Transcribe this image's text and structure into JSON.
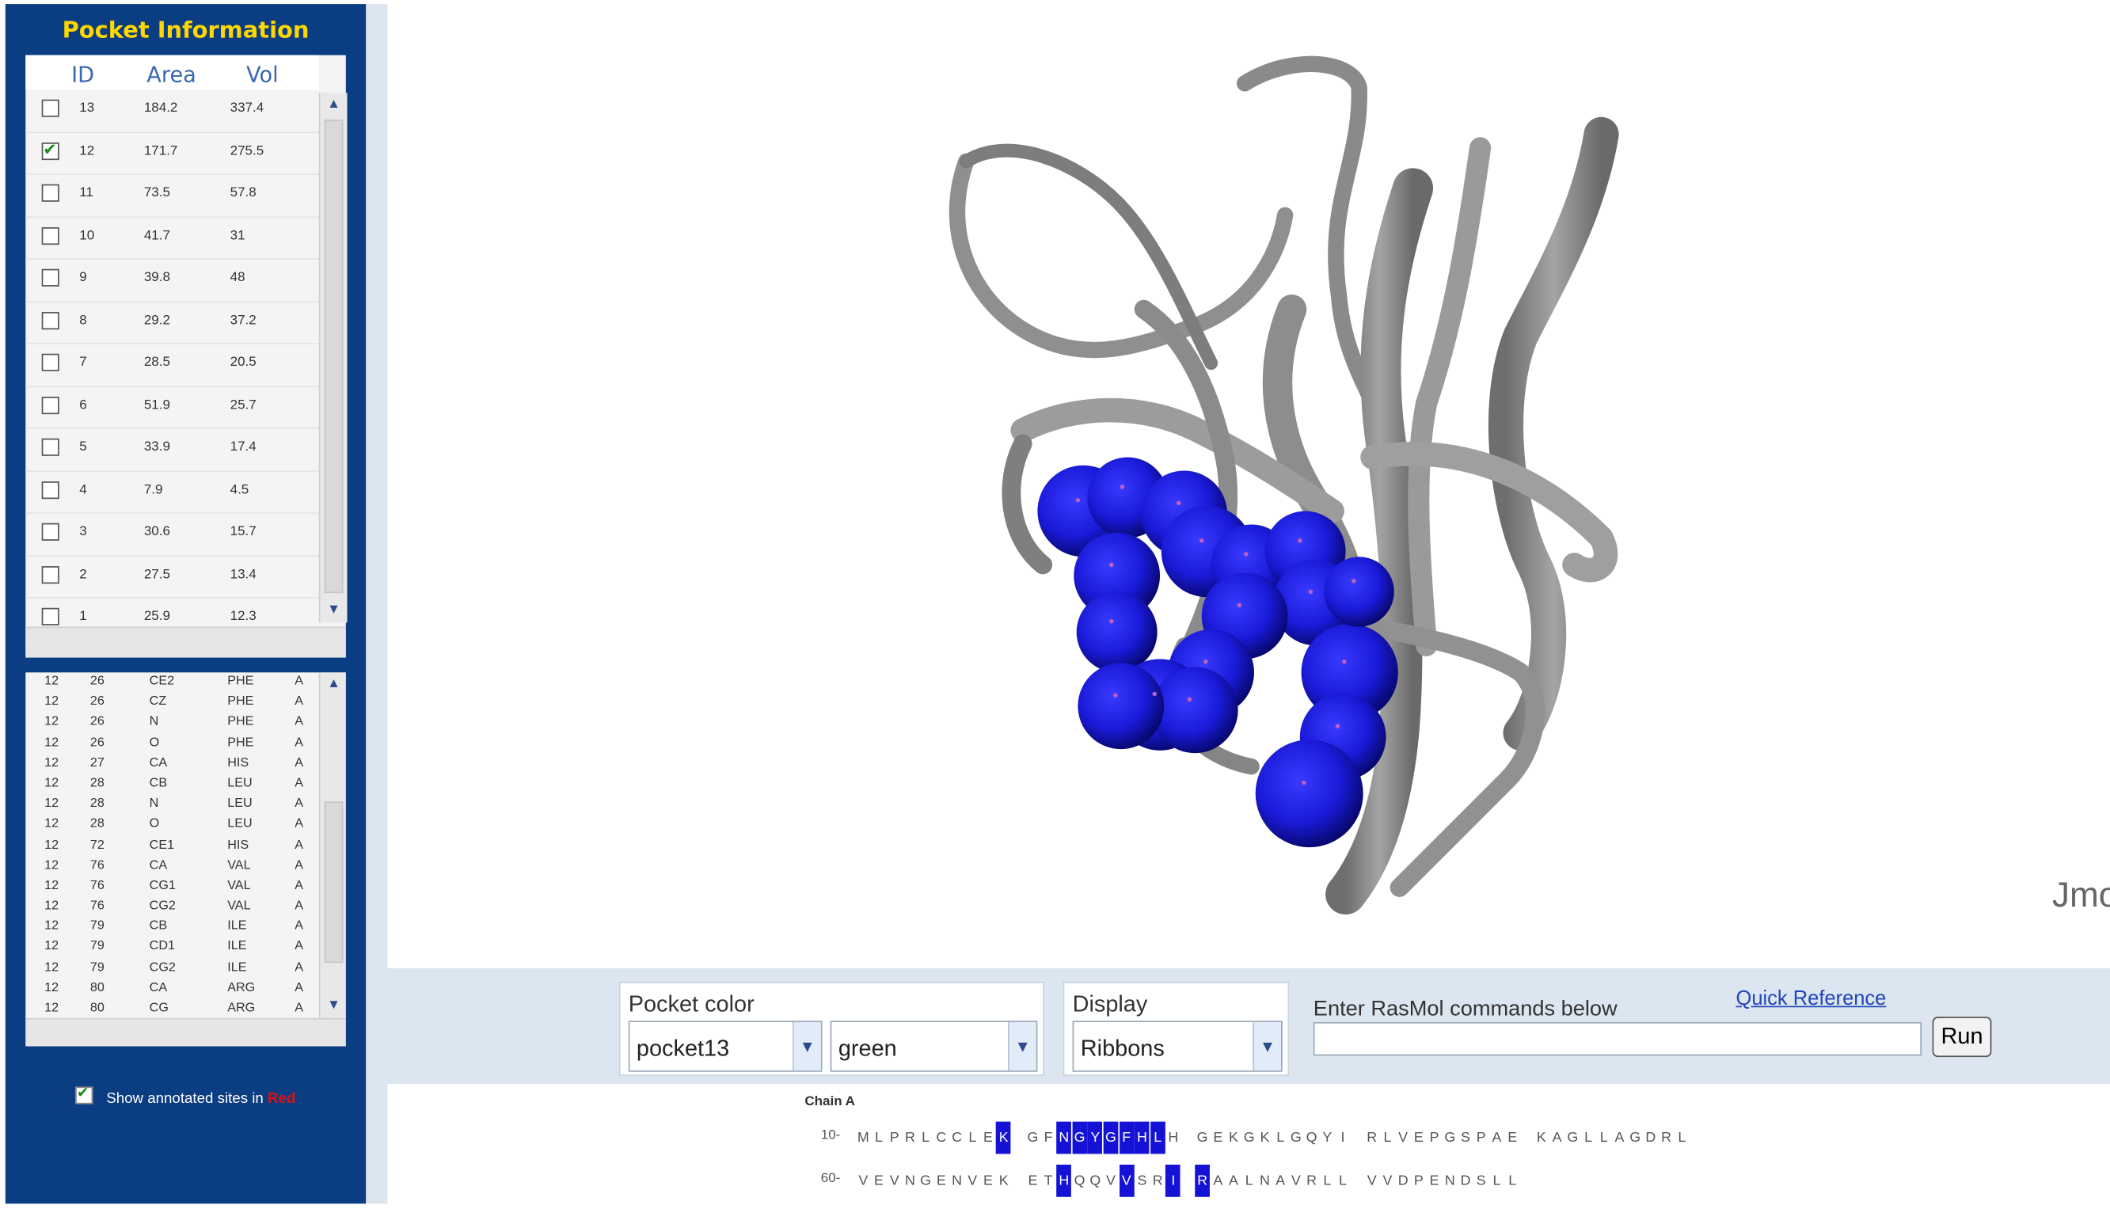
{
  "panel_title": "Pocket Information",
  "pocket_table": {
    "headers": {
      "id": "ID",
      "area": "Area",
      "vol": "Vol"
    },
    "rows": [
      {
        "id": "13",
        "area": "184.2",
        "vol": "337.4",
        "checked": false
      },
      {
        "id": "12",
        "area": "171.7",
        "vol": "275.5",
        "checked": true
      },
      {
        "id": "11",
        "area": "73.5",
        "vol": "57.8",
        "checked": false
      },
      {
        "id": "10",
        "area": "41.7",
        "vol": "31",
        "checked": false
      },
      {
        "id": "9",
        "area": "39.8",
        "vol": "48",
        "checked": false
      },
      {
        "id": "8",
        "area": "29.2",
        "vol": "37.2",
        "checked": false
      },
      {
        "id": "7",
        "area": "28.5",
        "vol": "20.5",
        "checked": false
      },
      {
        "id": "6",
        "area": "51.9",
        "vol": "25.7",
        "checked": false
      },
      {
        "id": "5",
        "area": "33.9",
        "vol": "17.4",
        "checked": false
      },
      {
        "id": "4",
        "area": "7.9",
        "vol": "4.5",
        "checked": false
      },
      {
        "id": "3",
        "area": "30.6",
        "vol": "15.7",
        "checked": false
      },
      {
        "id": "2",
        "area": "27.5",
        "vol": "13.4",
        "checked": false
      },
      {
        "id": "1",
        "area": "25.9",
        "vol": "12.3",
        "checked": false
      }
    ]
  },
  "atom_table": {
    "rows": [
      [
        "12",
        "26",
        "CE2",
        "PHE",
        "A"
      ],
      [
        "12",
        "26",
        "CZ",
        "PHE",
        "A"
      ],
      [
        "12",
        "26",
        "N",
        "PHE",
        "A"
      ],
      [
        "12",
        "26",
        "O",
        "PHE",
        "A"
      ],
      [
        "12",
        "27",
        "CA",
        "HIS",
        "A"
      ],
      [
        "12",
        "28",
        "CB",
        "LEU",
        "A"
      ],
      [
        "12",
        "28",
        "N",
        "LEU",
        "A"
      ],
      [
        "12",
        "28",
        "O",
        "LEU",
        "A"
      ],
      [
        "12",
        "72",
        "CE1",
        "HIS",
        "A"
      ],
      [
        "12",
        "76",
        "CA",
        "VAL",
        "A"
      ],
      [
        "12",
        "76",
        "CG1",
        "VAL",
        "A"
      ],
      [
        "12",
        "76",
        "CG2",
        "VAL",
        "A"
      ],
      [
        "12",
        "79",
        "CB",
        "ILE",
        "A"
      ],
      [
        "12",
        "79",
        "CD1",
        "ILE",
        "A"
      ],
      [
        "12",
        "79",
        "CG2",
        "ILE",
        "A"
      ],
      [
        "12",
        "80",
        "CA",
        "ARG",
        "A"
      ],
      [
        "12",
        "80",
        "CG",
        "ARG",
        "A"
      ]
    ]
  },
  "annotation": {
    "label": "Show annotated sites in",
    "color_word": "Red",
    "checked": true
  },
  "viewer": {
    "label": "Jmol"
  },
  "controls": {
    "pocket_color_label": "Pocket color",
    "pocket_select": "pocket13",
    "color_select": "green",
    "display_label": "Display",
    "display_select": "Ribbons",
    "rasmol_label": "Enter RasMol commands below",
    "quick_ref": "Quick Reference",
    "command_value": "",
    "run_label": "Run"
  },
  "sequence": {
    "chain_label": "Chain A",
    "lines": [
      {
        "num": "10-",
        "residues": "MLPRLCCLEKGFNGYGFHLHGEKGKLGQYIRLVEPGSPAEKAGLLAGDRL",
        "highlight": [
          9,
          12,
          13,
          14,
          15,
          16,
          17,
          18
        ]
      },
      {
        "num": "60-",
        "residues": "VEVNGENVEKETHQQVVSRIRAALNAVRLLVVDPENDSLL",
        "highlight": [
          12,
          16,
          19,
          20
        ]
      }
    ]
  },
  "colors": {
    "panel_blue": "#0b3d82",
    "title_yellow": "#ffd700",
    "sphere_blue": "#1a1ad8",
    "ribbon_gray": "#8c8c8c",
    "highlight_blue": "#1512d6"
  },
  "spheres": [
    [
      805,
      380,
      34
    ],
    [
      838,
      370,
      30
    ],
    [
      880,
      382,
      32
    ],
    [
      897,
      410,
      34
    ],
    [
      830,
      428,
      32
    ],
    [
      930,
      420,
      30
    ],
    [
      970,
      410,
      30
    ],
    [
      978,
      448,
      32
    ],
    [
      925,
      458,
      32
    ],
    [
      830,
      470,
      30
    ],
    [
      900,
      500,
      32
    ],
    [
      862,
      524,
      34
    ],
    [
      888,
      528,
      32
    ],
    [
      1003,
      500,
      36
    ],
    [
      998,
      548,
      32
    ],
    [
      973,
      590,
      40
    ],
    [
      1010,
      440,
      26
    ],
    [
      833,
      525,
      32
    ]
  ]
}
